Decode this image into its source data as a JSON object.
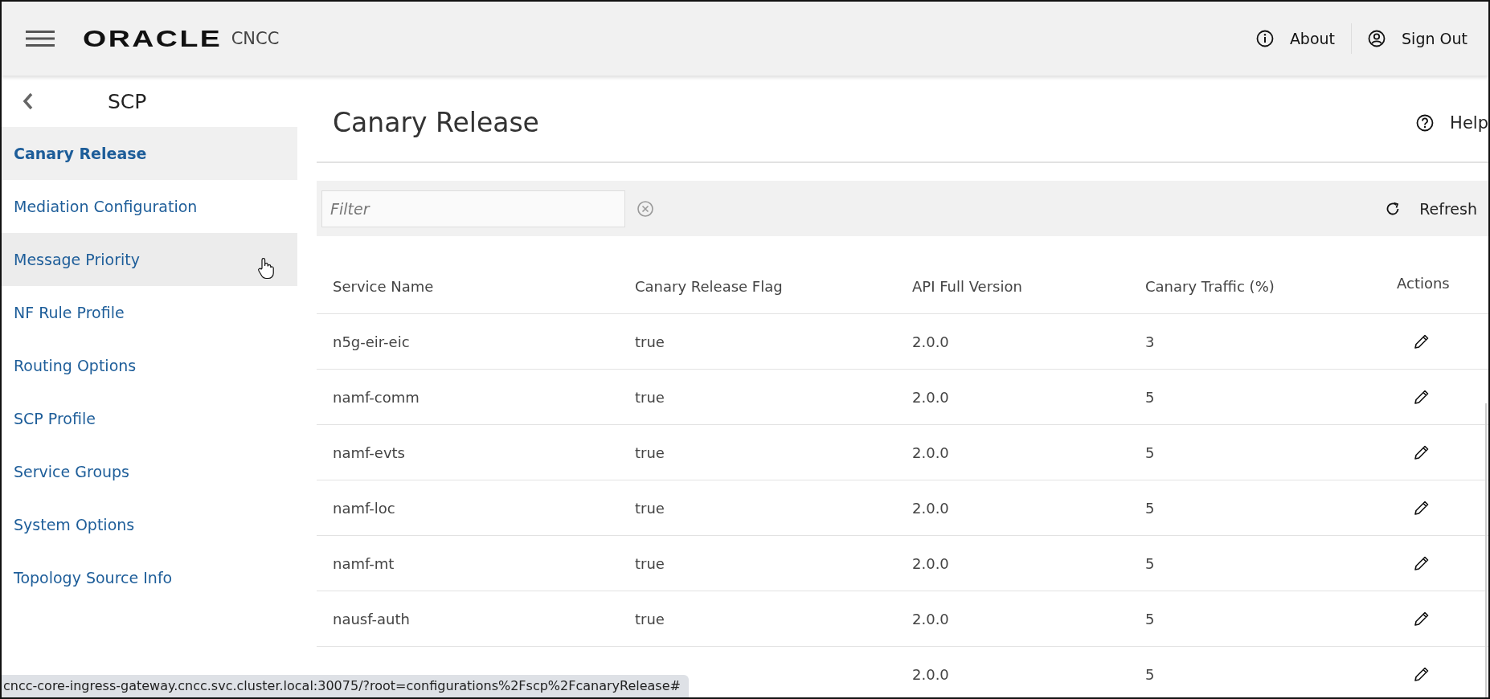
{
  "header": {
    "brand": "ORACLE",
    "product": "CNCC",
    "actions": [
      {
        "kind": "info",
        "label": "About"
      },
      {
        "kind": "user",
        "label": "Sign Out"
      }
    ]
  },
  "sidebar": {
    "title": "SCP",
    "items": [
      {
        "label": "Canary Release",
        "selected": true,
        "hovered": false
      },
      {
        "label": "Mediation Configuration",
        "selected": false,
        "hovered": false
      },
      {
        "label": "Message Priority",
        "selected": false,
        "hovered": true
      },
      {
        "label": "NF Rule Profile",
        "selected": false,
        "hovered": false
      },
      {
        "label": "Routing Options",
        "selected": false,
        "hovered": false
      },
      {
        "label": "SCP Profile",
        "selected": false,
        "hovered": false
      },
      {
        "label": "Service Groups",
        "selected": false,
        "hovered": false
      },
      {
        "label": "System Options",
        "selected": false,
        "hovered": false
      },
      {
        "label": "Topology Source Info",
        "selected": false,
        "hovered": false
      }
    ]
  },
  "page": {
    "title": "Canary Release",
    "help": "Help"
  },
  "toolbar": {
    "filter": {
      "placeholder": "Filter"
    },
    "refresh": "Refresh"
  },
  "table": {
    "columns": [
      "Service Name",
      "Canary Release Flag",
      "API Full Version",
      "Canary Traffic (%)",
      "Actions"
    ],
    "rows": [
      {
        "service_name": "n5g-eir-eic",
        "flag": "true",
        "version": "2.0.0",
        "traffic": "3"
      },
      {
        "service_name": "namf-comm",
        "flag": "true",
        "version": "2.0.0",
        "traffic": "5"
      },
      {
        "service_name": "namf-evts",
        "flag": "true",
        "version": "2.0.0",
        "traffic": "5"
      },
      {
        "service_name": "namf-loc",
        "flag": "true",
        "version": "2.0.0",
        "traffic": "5"
      },
      {
        "service_name": "namf-mt",
        "flag": "true",
        "version": "2.0.0",
        "traffic": "5"
      },
      {
        "service_name": "nausf-auth",
        "flag": "true",
        "version": "2.0.0",
        "traffic": "5"
      },
      {
        "version": "2.0.0",
        "traffic": "5"
      }
    ]
  },
  "status_bar": {
    "url": "cncc-core-ingress-gateway.cncc.svc.cluster.local:30075/?root=configurations%2Fscp%2FcanaryRelease#"
  }
}
